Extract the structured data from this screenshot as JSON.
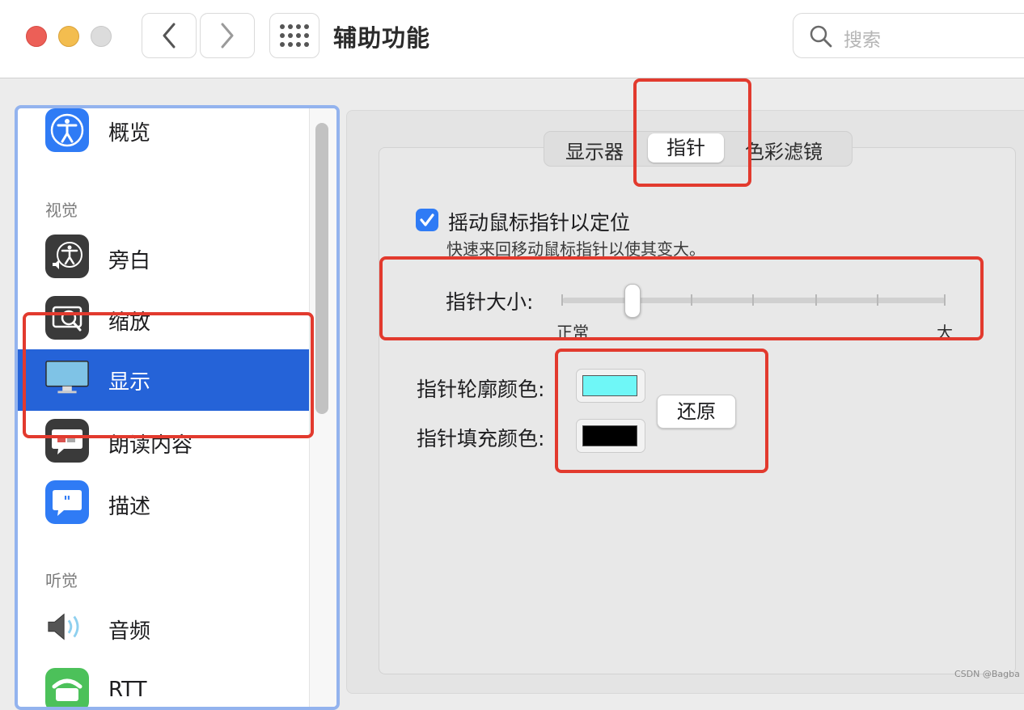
{
  "window": {
    "title": "辅助功能"
  },
  "toolbar": {
    "search_placeholder": "搜索",
    "icons": [
      "back-chevron-icon",
      "forward-chevron-icon",
      "grid-icon",
      "search-icon"
    ]
  },
  "sidebar": {
    "top_item": {
      "label": "概览",
      "icon": "accessibility-icon"
    },
    "sections": [
      {
        "title": "视觉",
        "items": [
          {
            "label": "旁白",
            "icon": "voiceover-icon"
          },
          {
            "label": "缩放",
            "icon": "zoom-icon"
          },
          {
            "label": "显示",
            "icon": "display-icon",
            "selected": true
          },
          {
            "label": "朗读内容",
            "icon": "speech-icon"
          },
          {
            "label": "描述",
            "icon": "description-icon"
          }
        ]
      },
      {
        "title": "听觉",
        "items": [
          {
            "label": "音频",
            "icon": "speaker-icon"
          },
          {
            "label": "RTT",
            "icon": "phone-icon"
          }
        ]
      }
    ]
  },
  "tabs": [
    {
      "label": "显示器"
    },
    {
      "label": "指针",
      "selected": true
    },
    {
      "label": "色彩滤镜"
    }
  ],
  "pointer": {
    "shake_checkbox": {
      "label": "摇动鼠标指针以定位",
      "checked": true
    },
    "shake_description": "快速来回移动鼠标指针以使其变大。",
    "size": {
      "label": "指针大小:",
      "min_label": "正常",
      "max_label": "大",
      "value_fraction": 0.18
    },
    "outline_color": {
      "label": "指针轮廓颜色:",
      "color": "#6ff7f7"
    },
    "fill_color": {
      "label": "指针填充颜色:",
      "color": "#000000"
    },
    "reset_label": "还原"
  },
  "colors": {
    "selection": "#2563d8",
    "annotation": "#e23a2e",
    "checkbox": "#2f7bf5"
  },
  "watermark": "CSDN @Bagba"
}
